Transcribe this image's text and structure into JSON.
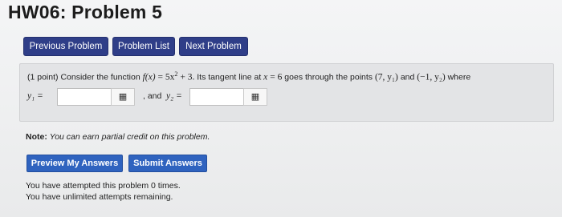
{
  "page": {
    "title": "HW06: Problem 5"
  },
  "nav": {
    "previous_label": "Previous Problem",
    "list_label": "Problem List",
    "next_label": "Next Problem"
  },
  "problem": {
    "points": "(1 point)",
    "intro": "Consider the function",
    "function_lhs": "f(x)",
    "eq": "=",
    "function_rhs_a": "5x",
    "function_exp": "2",
    "function_rhs_b": "+ 3.",
    "tangent_text": "Its tangent line at",
    "x_var": "x",
    "x_value": "6",
    "goes_text": "goes through the points",
    "point1": "(7, y₁)",
    "and_word": "and",
    "point2": "(−1, y₂)",
    "where_word": "where",
    "y1_label": "y₁ =",
    "y2_label": "y₂ =",
    "and_label": ", and",
    "y1_value": "",
    "y2_value": ""
  },
  "note": {
    "label": "Note:",
    "text": "You can earn partial credit on this problem."
  },
  "actions": {
    "preview_label": "Preview My Answers",
    "submit_label": "Submit Answers"
  },
  "attempts": {
    "line1": "You have attempted this problem 0 times.",
    "line2": "You have unlimited attempts remaining."
  },
  "icons": {
    "matrix": "matrix-entry-icon"
  }
}
